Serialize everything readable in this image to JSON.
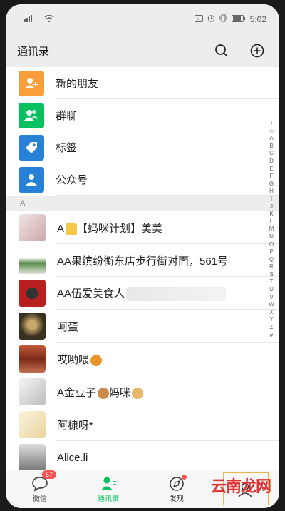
{
  "status_bar": {
    "time": "5:02",
    "left_icons": [
      "signal-icon",
      "wifi-icon"
    ],
    "right_icons": [
      "nfc-icon",
      "alarm-icon",
      "vibrate-icon",
      "battery-icon"
    ]
  },
  "header": {
    "title": "通讯录"
  },
  "features": [
    {
      "label": "新的朋友",
      "color": "#fa9d3b",
      "icon": "add-friend-icon"
    },
    {
      "label": "群聊",
      "color": "#07c160",
      "icon": "group-icon"
    },
    {
      "label": "标签",
      "color": "#2782d7",
      "icon": "tag-icon"
    },
    {
      "label": "公众号",
      "color": "#2782d7",
      "icon": "official-account-icon"
    }
  ],
  "section_header": "A",
  "contacts": [
    {
      "name": "A",
      "suffix": "【妈咪计划】美美",
      "emoji": "star-emoji",
      "avatar": "#d9c4c4"
    },
    {
      "name": "AA果缤纷衡东店步行街对面，561号",
      "avatar": "#dfe6d8"
    },
    {
      "name": "AA伍爱美食人",
      "blurred": true,
      "avatar": "#b81f1f"
    },
    {
      "name": "呵蛋",
      "avatar": "#7a6a45"
    },
    {
      "name": "哎哟喂",
      "emoji": "lion-emoji",
      "avatar": "#b04a2a"
    },
    {
      "name": "A金豆子",
      "suffix": "妈咪",
      "emoji": "dog-emoji",
      "emoji2": "cat-emoji",
      "avatar": "#d6d6d6"
    },
    {
      "name": "阿棣呀*",
      "avatar": "#f0e6c8"
    },
    {
      "name": "Alice.li",
      "avatar": "#a9a9a9"
    }
  ],
  "index_letters": [
    "↑",
    "☆",
    "A",
    "B",
    "C",
    "D",
    "E",
    "F",
    "G",
    "H",
    "I",
    "J",
    "K",
    "L",
    "M",
    "N",
    "O",
    "P",
    "Q",
    "R",
    "S",
    "T",
    "U",
    "V",
    "W",
    "X",
    "Y",
    "Z",
    "#"
  ],
  "tabs": [
    {
      "label": "微信",
      "badge": "57",
      "icon": "chat-icon"
    },
    {
      "label": "通讯录",
      "icon": "contacts-icon",
      "active": true
    },
    {
      "label": "发现",
      "icon": "compass-icon",
      "dot": true
    },
    {
      "label": "",
      "icon": "me-icon"
    }
  ],
  "watermark": "云南龙网",
  "colors": {
    "accent": "#07c160",
    "badge": "#fa5151"
  }
}
